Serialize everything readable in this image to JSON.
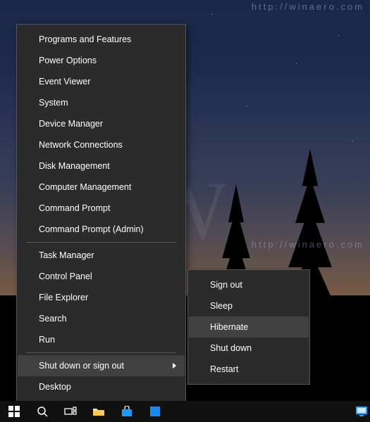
{
  "watermark": {
    "big": "W",
    "url": "http://winaero.com"
  },
  "mainMenu": {
    "items": [
      {
        "label": "Programs and Features",
        "hasSubmenu": false
      },
      {
        "label": "Power Options",
        "hasSubmenu": false
      },
      {
        "label": "Event Viewer",
        "hasSubmenu": false
      },
      {
        "label": "System",
        "hasSubmenu": false
      },
      {
        "label": "Device Manager",
        "hasSubmenu": false
      },
      {
        "label": "Network Connections",
        "hasSubmenu": false
      },
      {
        "label": "Disk Management",
        "hasSubmenu": false
      },
      {
        "label": "Computer Management",
        "hasSubmenu": false
      },
      {
        "label": "Command Prompt",
        "hasSubmenu": false
      },
      {
        "label": "Command Prompt (Admin)",
        "hasSubmenu": false
      }
    ],
    "items2": [
      {
        "label": "Task Manager"
      },
      {
        "label": "Control Panel"
      },
      {
        "label": "File Explorer"
      },
      {
        "label": "Search"
      },
      {
        "label": "Run"
      }
    ],
    "items3": [
      {
        "label": "Shut down or sign out",
        "hasSubmenu": true,
        "highlighted": true
      },
      {
        "label": "Desktop"
      }
    ]
  },
  "subMenu": {
    "items": [
      {
        "label": "Sign out"
      },
      {
        "label": "Sleep"
      },
      {
        "label": "Hibernate",
        "highlighted": true
      },
      {
        "label": "Shut down"
      },
      {
        "label": "Restart"
      }
    ]
  }
}
